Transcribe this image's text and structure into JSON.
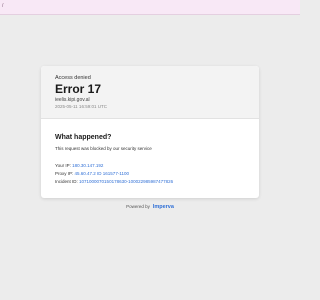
{
  "topbar": {
    "glyph": "/"
  },
  "header": {
    "access_denied": "Access denied",
    "error_title": "Error 17",
    "domain": "ieelis.kipi.gov.al",
    "timestamp": "2025-05-11 16:59:01 UTC"
  },
  "body": {
    "section_title": "What happened?",
    "blocked_text": "This request was blocked by our security service",
    "your_ip_label": "Your IP:",
    "your_ip_value": "180.30.147.192",
    "proxy_ip_label": "Proxy IP:",
    "proxy_ip_value": "45.60.47.2 ID 161577-1100",
    "incident_id_label": "Incident ID:",
    "incident_id_value": "1071000070150178630-100022985987477826"
  },
  "footer": {
    "powered_by": "Powered by",
    "brand": "Imperva"
  },
  "colors": {
    "background": "#ececec",
    "topbar": "#f8e8f6",
    "link": "#2f6fd6"
  }
}
